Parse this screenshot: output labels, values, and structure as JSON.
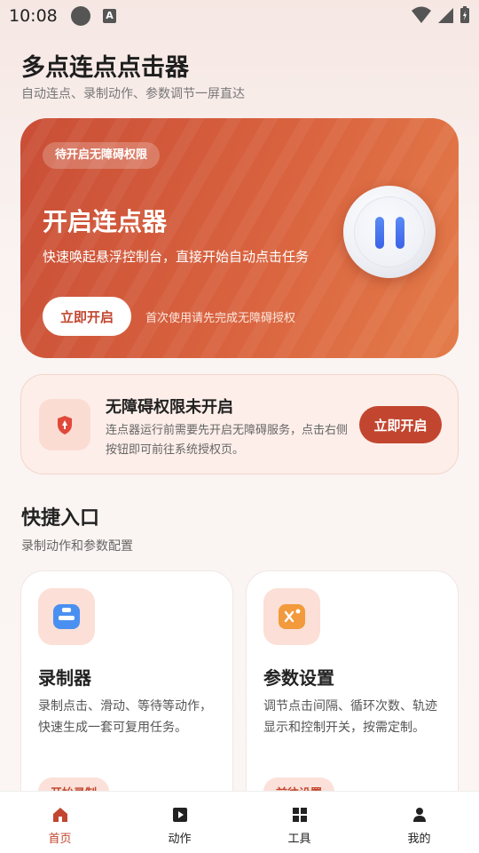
{
  "status": {
    "time": "10:08"
  },
  "header": {
    "title": "多点连点点击器",
    "subtitle": "自动连点、录制动作、参数调节一屏直达"
  },
  "hero": {
    "badge": "待开启无障碍权限",
    "title": "开启连点器",
    "description": "快速唤起悬浮控制台，直接开始自动点击任务",
    "button": "立即开启",
    "note": "首次使用请先完成无障碍授权"
  },
  "permission": {
    "title": "无障碍权限未开启",
    "description": "连点器运行前需要先开启无障碍服务，点击右侧按钮即可前往系统授权页。",
    "button": "立即开启"
  },
  "section": {
    "title": "快捷入口",
    "subtitle": "录制动作和参数配置"
  },
  "cards": [
    {
      "icon": "recorder-icon",
      "title": "录制器",
      "description": "录制点击、滑动、等待等动作，快速生成一套可复用任务。",
      "link": "开始录制"
    },
    {
      "icon": "settings-icon",
      "title": "参数设置",
      "description": "调节点击间隔、循环次数、轨迹显示和控制开关，按需定制。",
      "link": "前往设置"
    }
  ],
  "nav": [
    {
      "label": "首页",
      "icon": "home-icon",
      "active": true
    },
    {
      "label": "动作",
      "icon": "play-icon",
      "active": false
    },
    {
      "label": "工具",
      "icon": "grid-icon",
      "active": false
    },
    {
      "label": "我的",
      "icon": "user-icon",
      "active": false
    }
  ],
  "colors": {
    "accent": "#c2462f",
    "hero_gradient_start": "#c94e36",
    "hero_gradient_end": "#e47c4a",
    "blue_icon": "#4a90f0",
    "orange_icon": "#f29a3c"
  }
}
